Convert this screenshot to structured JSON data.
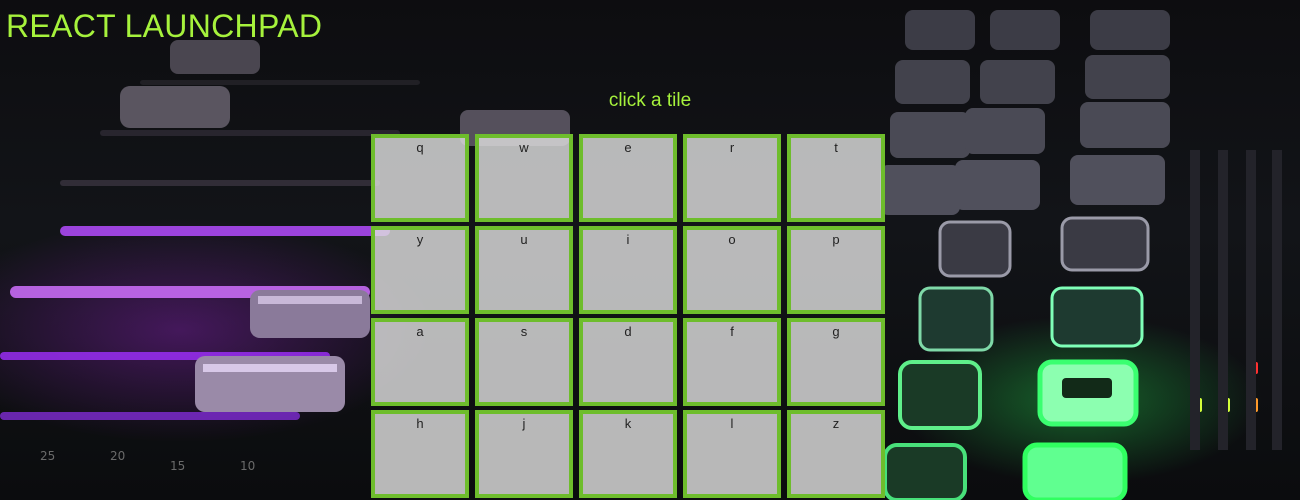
{
  "header": {
    "title": "REACT LAUNCHPAD",
    "prompt": "click a tile"
  },
  "pads": [
    {
      "key": "q"
    },
    {
      "key": "w"
    },
    {
      "key": "e"
    },
    {
      "key": "r"
    },
    {
      "key": "t"
    },
    {
      "key": "y"
    },
    {
      "key": "u"
    },
    {
      "key": "i"
    },
    {
      "key": "o"
    },
    {
      "key": "p"
    },
    {
      "key": "a"
    },
    {
      "key": "s"
    },
    {
      "key": "d"
    },
    {
      "key": "f"
    },
    {
      "key": "g"
    },
    {
      "key": "h"
    },
    {
      "key": "j"
    },
    {
      "key": "k"
    },
    {
      "key": "l"
    },
    {
      "key": "z"
    }
  ],
  "colors": {
    "accent": "#a6f23c",
    "pad_border": "#6ebd2c",
    "pad_fill": "#dedede",
    "fader_glow": "#c040ff",
    "button_glow": "#36ff6a"
  },
  "background": {
    "icon": "mixing-console-image"
  }
}
